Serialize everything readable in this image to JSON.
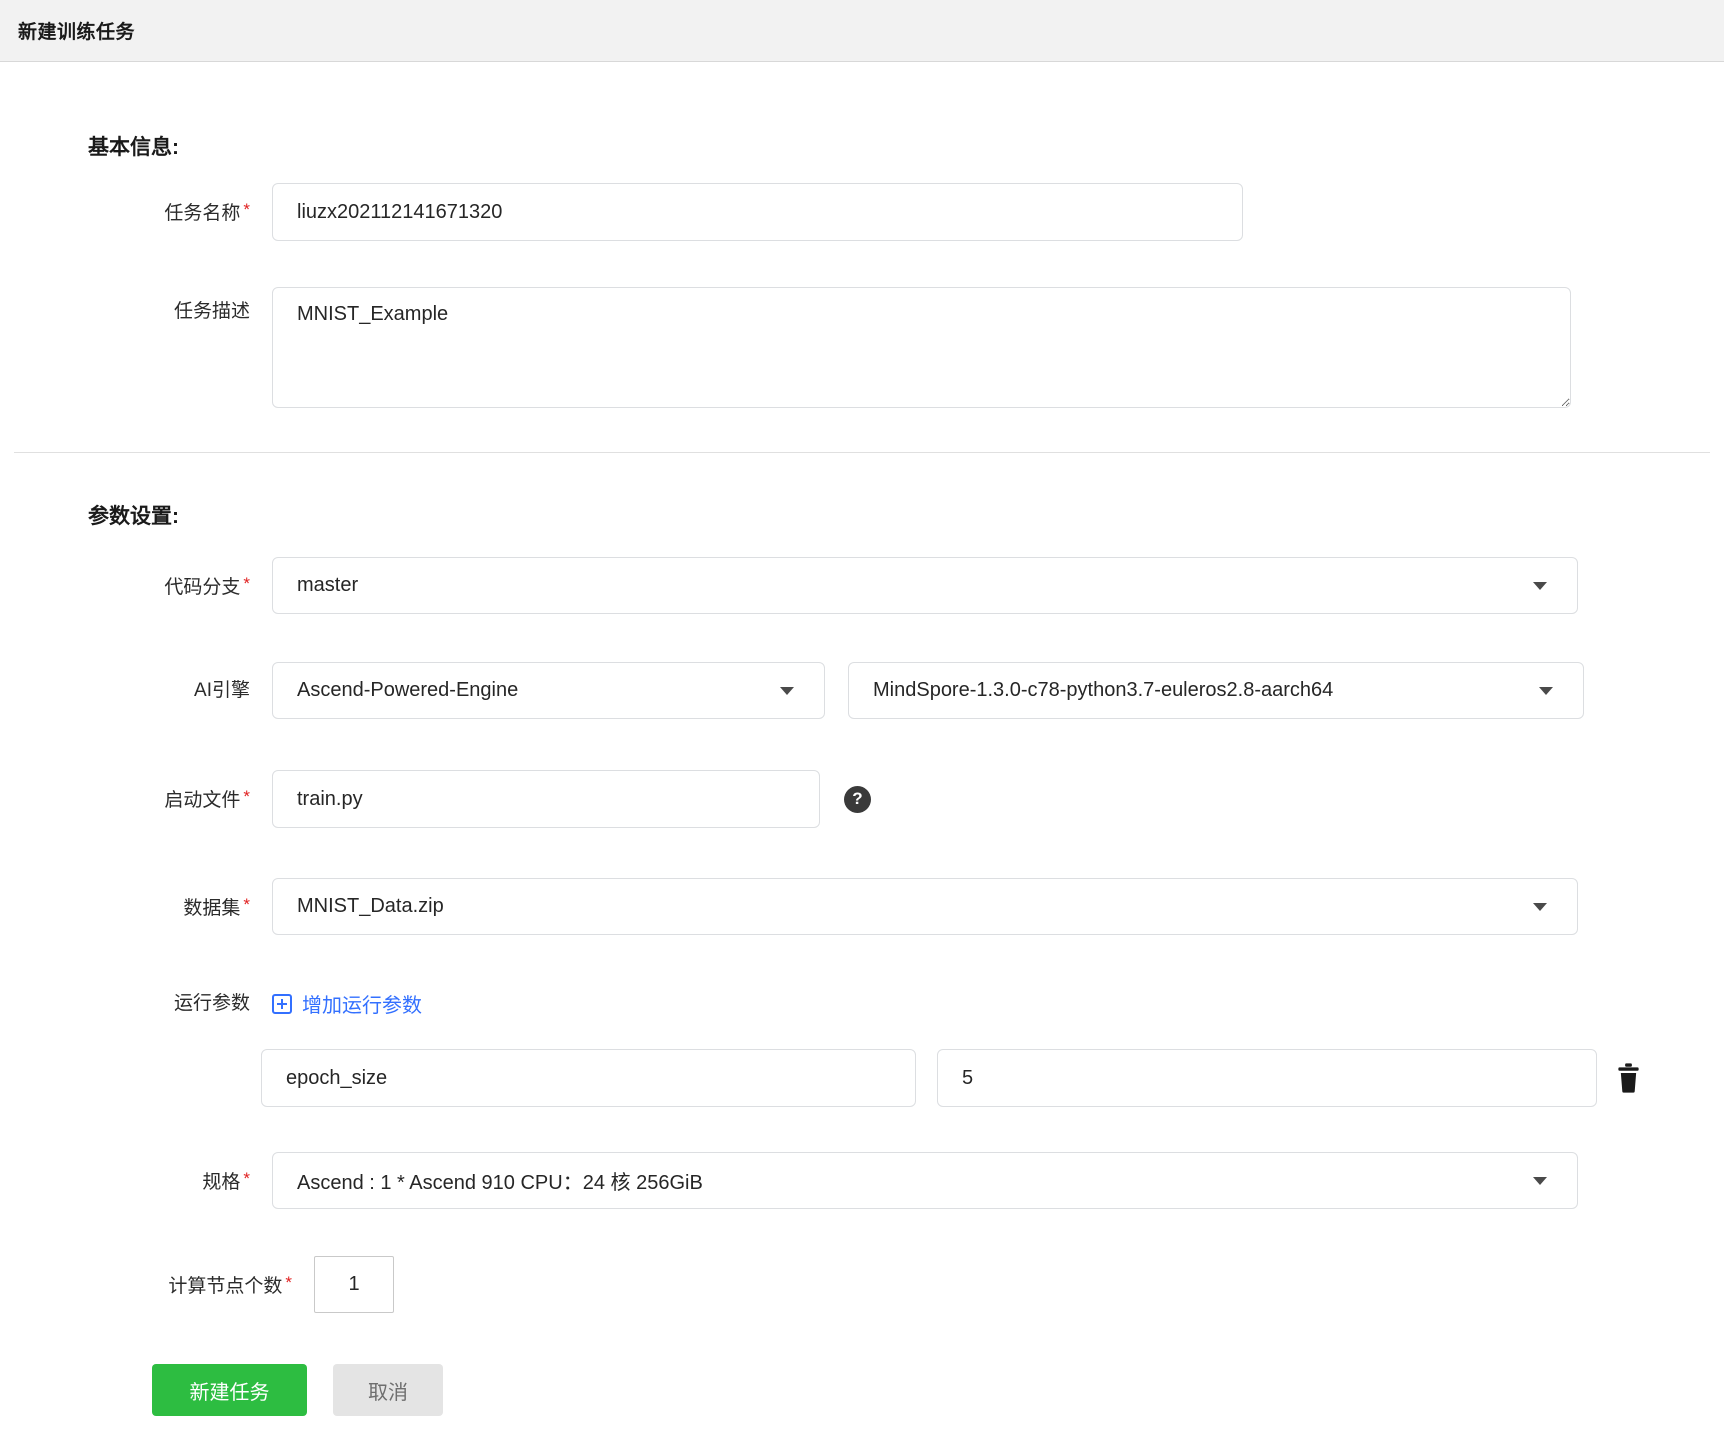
{
  "colors": {
    "primary_green": "#2dbd41",
    "link_blue": "#3370ff",
    "required_red": "#e02020",
    "header_bg": "#f2f2f2"
  },
  "misc": {
    "required_mark": "*"
  },
  "header": {
    "title": "新建训练任务"
  },
  "basic_section": {
    "heading": "基本信息:",
    "task_name": {
      "label": "任务名称",
      "value": "liuzx202112141671320"
    },
    "task_desc": {
      "label": "任务描述",
      "value": "MNIST_Example"
    }
  },
  "params_section": {
    "heading": "参数设置:",
    "code_branch": {
      "label": "代码分支",
      "value": "master"
    },
    "ai_engine": {
      "label": "AI引擎",
      "engine": "Ascend-Powered-Engine",
      "version": "MindSpore-1.3.0-c78-python3.7-euleros2.8-aarch64"
    },
    "boot_file": {
      "label": "启动文件",
      "value": "train.py",
      "help_glyph": "?"
    },
    "dataset": {
      "label": "数据集",
      "value": "MNIST_Data.zip"
    },
    "run_params": {
      "label": "运行参数",
      "add_label": "增加运行参数",
      "rows": [
        {
          "name": "epoch_size",
          "value": "5"
        }
      ]
    },
    "spec": {
      "label": "规格",
      "value": "Ascend : 1 * Ascend 910 CPU：24 核 256GiB"
    },
    "node_count": {
      "label": "计算节点个数",
      "value": "1"
    }
  },
  "footer": {
    "submit_label": "新建任务",
    "cancel_label": "取消"
  },
  "icons": {
    "help": "question-circle",
    "add": "plus-square",
    "delete": "trash",
    "dropdown": "caret-down"
  }
}
